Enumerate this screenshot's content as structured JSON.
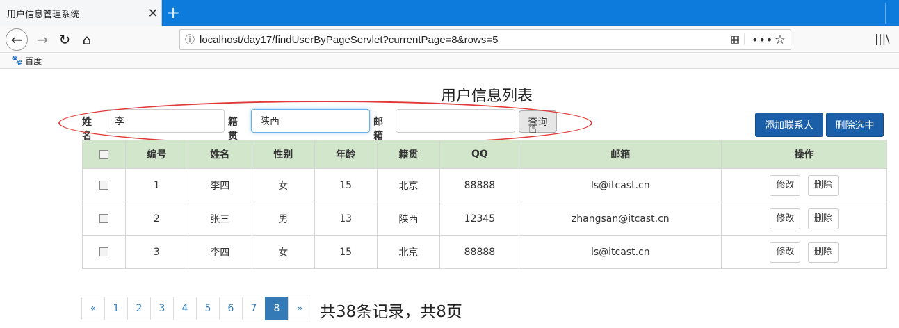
{
  "browser": {
    "tab_title": "用户信息管理系统",
    "tab_close": "✕",
    "new_tab": "+",
    "url": "localhost/day17/findUserByPageServlet?currentPage=8&rows=5",
    "bookmark": "百度"
  },
  "page": {
    "title": "用户信息列表",
    "search": {
      "name_label": "姓名",
      "name_value": "李",
      "address_label": "籍贯",
      "address_value": "陕西",
      "email_label": "邮箱",
      "email_value": "",
      "submit_label": "查询"
    },
    "actions": {
      "add_label": "添加联系人",
      "delete_selected_label": "删除选中"
    },
    "table": {
      "headers": [
        "编号",
        "姓名",
        "性别",
        "年龄",
        "籍贯",
        "QQ",
        "邮箱",
        "操作"
      ],
      "rows": [
        {
          "id": "1",
          "name": "李四",
          "gender": "女",
          "age": "15",
          "address": "北京",
          "qq": "88888",
          "email": "ls@itcast.cn"
        },
        {
          "id": "2",
          "name": "张三",
          "gender": "男",
          "age": "13",
          "address": "陕西",
          "qq": "12345",
          "email": "zhangsan@itcast.cn"
        },
        {
          "id": "3",
          "name": "李四",
          "gender": "女",
          "age": "15",
          "address": "北京",
          "qq": "88888",
          "email": "ls@itcast.cn"
        }
      ],
      "edit_label": "修改",
      "delete_label": "删除"
    },
    "pagination": {
      "prev": "«",
      "pages": [
        "1",
        "2",
        "3",
        "4",
        "5",
        "6",
        "7",
        "8"
      ],
      "current": "8",
      "next": "»",
      "total_text": "共38条记录，共8页"
    }
  },
  "colors": {
    "primary_button": "#1a5fa8",
    "table_header": "#d2e6cc",
    "annotation_ellipse": "#e23a3a",
    "active_page": "#337ab7"
  }
}
